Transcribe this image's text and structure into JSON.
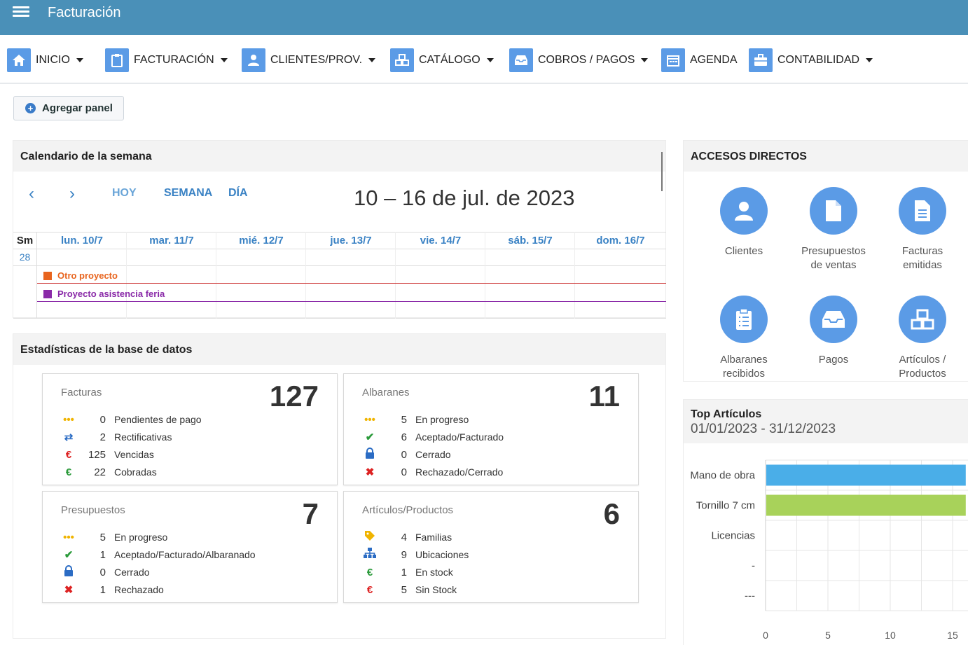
{
  "app": {
    "title": "Facturación"
  },
  "nav": [
    {
      "label": "INICIO",
      "icon": "home-icon",
      "caret": true
    },
    {
      "label": "FACTURACIÓN",
      "icon": "clipboard-icon",
      "caret": true
    },
    {
      "label": "CLIENTES/PROV.",
      "icon": "user-icon",
      "caret": true
    },
    {
      "label": "CATÁLOGO",
      "icon": "cubes-icon",
      "caret": true
    },
    {
      "label": "COBROS / PAGOS",
      "icon": "inbox-icon",
      "caret": true
    },
    {
      "label": "AGENDA",
      "icon": "calendar-icon",
      "caret": false
    },
    {
      "label": "CONTABILIDAD",
      "icon": "briefcase-icon",
      "caret": true
    }
  ],
  "add_panel": {
    "label": "Agregar panel"
  },
  "calendar": {
    "title": "Calendario de la semana",
    "prev": "‹",
    "next": "›",
    "today": "HOY",
    "week": "SEMANA",
    "day": "DÍA",
    "range": "10 – 16 de jul. de 2023",
    "week_header": "Sm",
    "week_number": "28",
    "days": [
      "lun. 10/7",
      "mar. 11/7",
      "mié. 12/7",
      "jue. 13/7",
      "vie. 14/7",
      "sáb. 15/7",
      "dom. 16/7"
    ],
    "events": [
      {
        "label": "Otro proyecto",
        "color": "#e8641e"
      },
      {
        "label": "Proyecto asistencia feria",
        "color": "#8a2aa8"
      }
    ]
  },
  "stats": {
    "title": "Estadísticas de la base de datos",
    "boxes": [
      {
        "title": "Facturas",
        "total": "127",
        "rows": [
          {
            "icon": "dots-icon",
            "count": "0",
            "label": "Pendientes de pago"
          },
          {
            "icon": "exchange-icon",
            "count": "2",
            "label": "Rectificativas"
          },
          {
            "icon": "euro-red-icon",
            "count": "125",
            "label": "Vencidas"
          },
          {
            "icon": "euro-green-icon",
            "count": "22",
            "label": "Cobradas"
          }
        ]
      },
      {
        "title": "Albaranes",
        "total": "11",
        "rows": [
          {
            "icon": "dots-icon",
            "count": "5",
            "label": "En progreso"
          },
          {
            "icon": "check-icon",
            "count": "6",
            "label": "Aceptado/Facturado"
          },
          {
            "icon": "lock-icon",
            "count": "0",
            "label": "Cerrado"
          },
          {
            "icon": "cross-icon",
            "count": "0",
            "label": "Rechazado/Cerrado"
          }
        ]
      },
      {
        "title": "Presupuestos",
        "total": "7",
        "rows": [
          {
            "icon": "dots-icon",
            "count": "5",
            "label": "En progreso"
          },
          {
            "icon": "check-icon",
            "count": "1",
            "label": "Aceptado/Facturado/Albaranado"
          },
          {
            "icon": "lock-icon",
            "count": "0",
            "label": "Cerrado"
          },
          {
            "icon": "cross-icon",
            "count": "1",
            "label": "Rechazado"
          }
        ]
      },
      {
        "title": "Artículos/Productos",
        "total": "6",
        "rows": [
          {
            "icon": "tag-icon",
            "count": "4",
            "label": "Familias"
          },
          {
            "icon": "sitemap-icon",
            "count": "9",
            "label": "Ubicaciones"
          },
          {
            "icon": "euro-green-icon",
            "count": "1",
            "label": "En stock"
          },
          {
            "icon": "euro-red-icon",
            "count": "5",
            "label": "Sin Stock"
          }
        ]
      }
    ]
  },
  "shortcuts": {
    "title": "ACCESOS DIRECTOS",
    "items": [
      {
        "label1": "Clientes",
        "label2": "",
        "icon": "user-icon"
      },
      {
        "label1": "Presupuestos",
        "label2": "de ventas",
        "icon": "file-icon"
      },
      {
        "label1": "Facturas",
        "label2": "emitidas",
        "icon": "file-text-icon"
      },
      {
        "label1": "Albaranes",
        "label2": "recibidos",
        "icon": "clipboard-list-icon"
      },
      {
        "label1": "Pagos",
        "label2": "",
        "icon": "inbox-icon"
      },
      {
        "label1": "Artículos /",
        "label2": "Productos",
        "icon": "cubes-icon"
      }
    ]
  },
  "top_articles": {
    "title": "Top Artículos",
    "period": "01/01/2023 - 31/12/2023"
  },
  "chart_data": {
    "type": "bar",
    "orientation": "horizontal",
    "categories": [
      "Mano de obra",
      "Tornillo 7 cm",
      "Licencias",
      "-",
      "---"
    ],
    "values": [
      16,
      16,
      0,
      0,
      0
    ],
    "colors": [
      "#4aaee8",
      "#a8d25a",
      "#4aaee8",
      "#4aaee8",
      "#4aaee8"
    ],
    "xticks": [
      "0",
      "5",
      "10",
      "15"
    ],
    "xlim": [
      0,
      15
    ],
    "grid": true
  }
}
